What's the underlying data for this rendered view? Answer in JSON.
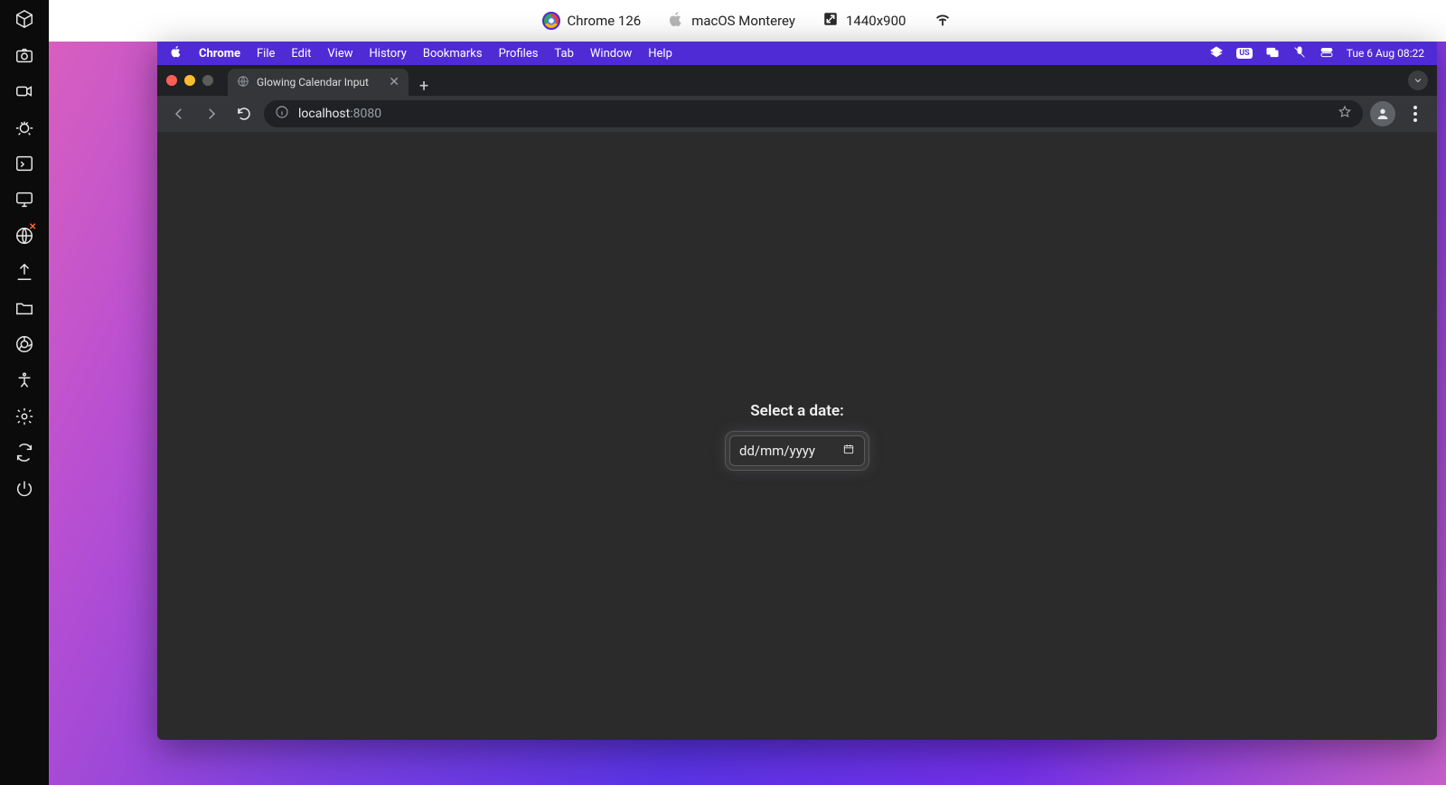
{
  "info_bar": {
    "browser": "Chrome 126",
    "os": "macOS Monterey",
    "resolution": "1440x900"
  },
  "menu_bar": {
    "app": "Chrome",
    "items": [
      "File",
      "Edit",
      "View",
      "History",
      "Bookmarks",
      "Profiles",
      "Tab",
      "Window",
      "Help"
    ],
    "input_source": "US",
    "clock": "Tue 6 Aug  08:22"
  },
  "tab": {
    "title": "Glowing Calendar Input"
  },
  "address": {
    "host": "localhost",
    "port": ":8080"
  },
  "page": {
    "label": "Select a date:",
    "placeholder": "dd/mm/yyyy"
  },
  "icons": {
    "cube": "cube",
    "camera": "camera",
    "video": "video",
    "bug": "bug",
    "terminal": "terminal",
    "monitor": "monitor",
    "globe": "globe",
    "upload": "upload",
    "folder": "folder",
    "chrome": "chrome",
    "person": "person",
    "gear": "gear",
    "sync": "sync",
    "power": "power"
  }
}
